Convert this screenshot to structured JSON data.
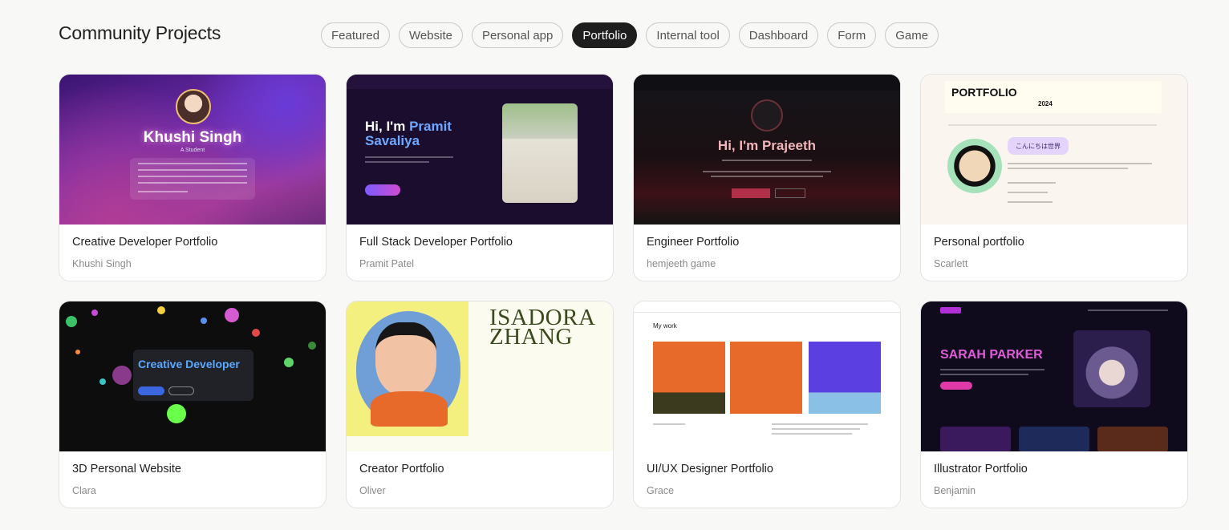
{
  "page": {
    "title": "Community Projects"
  },
  "filters": [
    {
      "label": "Featured",
      "active": false
    },
    {
      "label": "Website",
      "active": false
    },
    {
      "label": "Personal app",
      "active": false
    },
    {
      "label": "Portfolio",
      "active": true
    },
    {
      "label": "Internal tool",
      "active": false
    },
    {
      "label": "Dashboard",
      "active": false
    },
    {
      "label": "Form",
      "active": false
    },
    {
      "label": "Game",
      "active": false
    }
  ],
  "projects": [
    {
      "title": "Creative Developer Portfolio",
      "author": "Khushi Singh",
      "preview": {
        "name": "Khushi Singh",
        "subtitle": "A Student"
      }
    },
    {
      "title": "Full Stack Developer Portfolio",
      "author": "Pramit Patel",
      "preview": {
        "greeting": "Hi, I'm ",
        "first": "Pramit",
        "last": "Savaliya"
      }
    },
    {
      "title": "Engineer Portfolio",
      "author": "hemjeeth game",
      "preview": {
        "greeting": "Hi, I'm Prajeeth"
      }
    },
    {
      "title": "Personal portfolio",
      "author": "Scarlett",
      "preview": {
        "heading": "PORTFOLIO",
        "year": "2024",
        "hello": "こんにちは世界"
      }
    },
    {
      "title": "3D Personal Website",
      "author": "Clara",
      "preview": {
        "heading": "Creative Developer"
      }
    },
    {
      "title": "Creator Portfolio",
      "author": "Oliver",
      "preview": {
        "line1": "ISADORA",
        "line2": "ZHANG"
      }
    },
    {
      "title": "UI/UX Designer Portfolio",
      "author": "Grace",
      "preview": {
        "heading": "My work"
      }
    },
    {
      "title": "Illustrator Portfolio",
      "author": "Benjamin",
      "preview": {
        "heading": "SARAH PARKER"
      }
    }
  ]
}
